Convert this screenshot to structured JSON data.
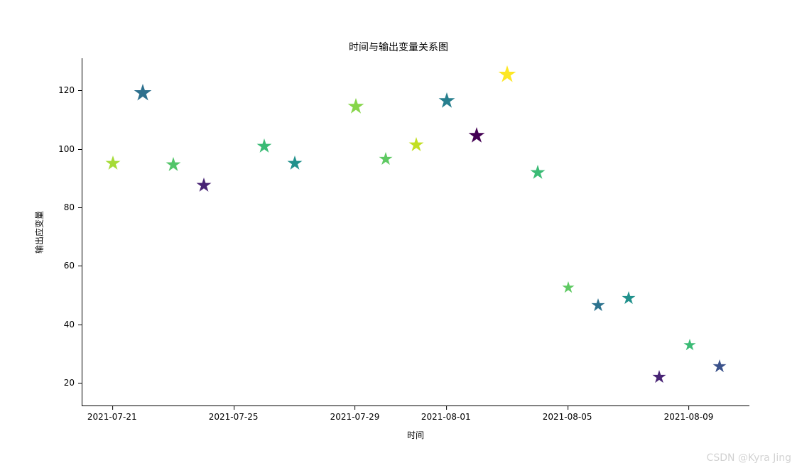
{
  "chart_data": {
    "type": "scatter",
    "title": "时间与输出变量关系图",
    "xlabel": "时间",
    "ylabel": "输出应变量",
    "x_axis_type": "date",
    "x_range": [
      "2021-07-20",
      "2021-08-11"
    ],
    "y_range": [
      12,
      131
    ],
    "y_ticks": [
      20,
      40,
      60,
      80,
      100,
      120
    ],
    "x_ticks": [
      "2021-07-21",
      "2021-07-25",
      "2021-07-29",
      "2021-08-01",
      "2021-08-05",
      "2021-08-09"
    ],
    "points": [
      {
        "x": "2021-07-21",
        "y": 94.5,
        "size": 22,
        "color": "#a5db36"
      },
      {
        "x": "2021-07-22",
        "y": 118.5,
        "size": 26,
        "color": "#2d708e"
      },
      {
        "x": "2021-07-23",
        "y": 94.0,
        "size": 22,
        "color": "#52c569"
      },
      {
        "x": "2021-07-24",
        "y": 87.0,
        "size": 22,
        "color": "#482475"
      },
      {
        "x": "2021-07-26",
        "y": 100.5,
        "size": 22,
        "color": "#3bbb75"
      },
      {
        "x": "2021-07-27",
        "y": 94.5,
        "size": 22,
        "color": "#21918c"
      },
      {
        "x": "2021-07-29",
        "y": 114.0,
        "size": 24,
        "color": "#86d549"
      },
      {
        "x": "2021-07-30",
        "y": 96.0,
        "size": 20,
        "color": "#5ec962"
      },
      {
        "x": "2021-07-31",
        "y": 101.0,
        "size": 22,
        "color": "#c2df23"
      },
      {
        "x": "2021-08-01",
        "y": 116.0,
        "size": 24,
        "color": "#277f8e"
      },
      {
        "x": "2021-08-02",
        "y": 104.0,
        "size": 24,
        "color": "#440154"
      },
      {
        "x": "2021-08-03",
        "y": 125.0,
        "size": 26,
        "color": "#fde725"
      },
      {
        "x": "2021-08-04",
        "y": 91.5,
        "size": 22,
        "color": "#3bbb75"
      },
      {
        "x": "2021-08-05",
        "y": 52.0,
        "size": 18,
        "color": "#5ec962"
      },
      {
        "x": "2021-08-06",
        "y": 46.0,
        "size": 20,
        "color": "#2c728e"
      },
      {
        "x": "2021-08-07",
        "y": 48.5,
        "size": 20,
        "color": "#21918c"
      },
      {
        "x": "2021-08-08",
        "y": 21.5,
        "size": 20,
        "color": "#482475"
      },
      {
        "x": "2021-08-09",
        "y": 32.5,
        "size": 18,
        "color": "#3bbb75"
      },
      {
        "x": "2021-08-10",
        "y": 25.0,
        "size": 20,
        "color": "#3b528b"
      }
    ]
  },
  "watermark": "CSDN @Kyra Jing"
}
